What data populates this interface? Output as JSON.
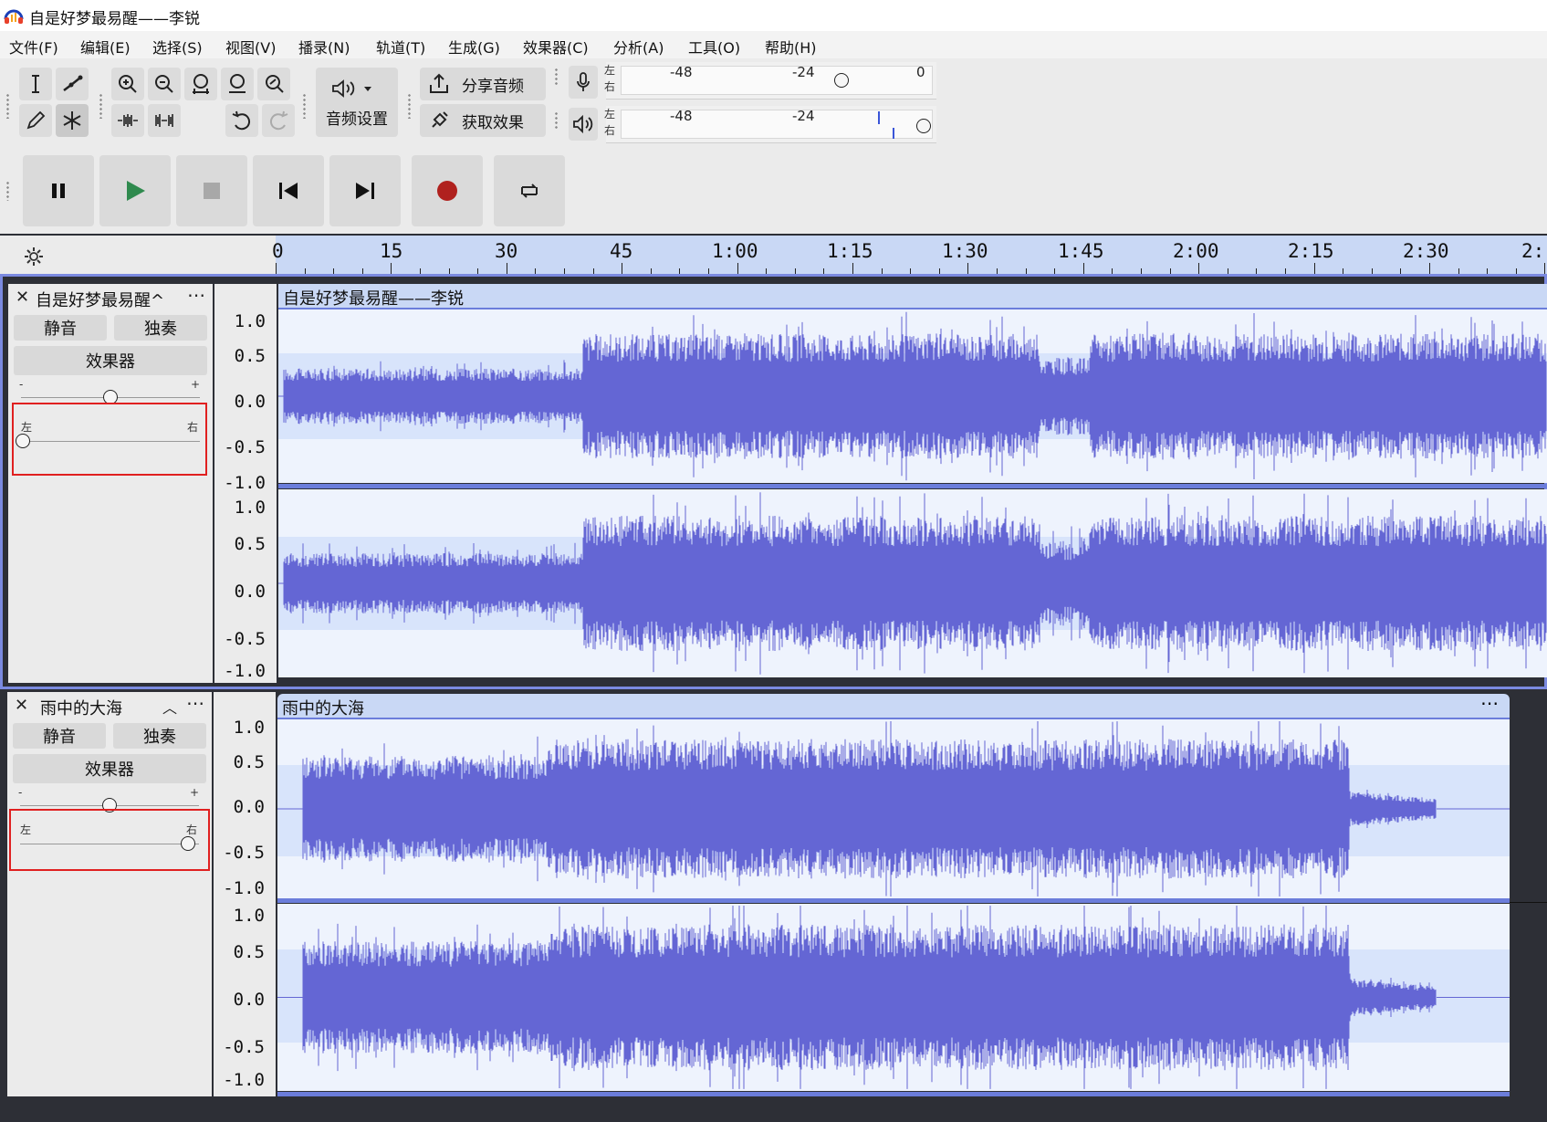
{
  "window": {
    "title": "自是好梦最易醒——李锐"
  },
  "menu": [
    "文件(F)",
    "编辑(E)",
    "选择(S)",
    "视图(V)",
    "播录(N)",
    "轨道(T)",
    "生成(G)",
    "效果器(C)",
    "分析(A)",
    "工具(O)",
    "帮助(H)"
  ],
  "toolbar": {
    "audio_settings": "音频设置",
    "share_audio": "分享音频",
    "get_effects": "获取效果",
    "meter_left": "左",
    "meter_right": "右",
    "rec_meter_ticks": [
      "-48",
      "-24",
      "0"
    ],
    "play_meter_ticks": [
      "-48",
      "-24"
    ]
  },
  "ruler": {
    "labels": [
      "0",
      "15",
      "30",
      "45",
      "1:00",
      "1:15",
      "1:30",
      "1:45",
      "2:00",
      "2:15",
      "2:30",
      "2:"
    ]
  },
  "tracks": [
    {
      "name": "自是好梦最易醒^",
      "clip_name": "自是好梦最易醒——李锐",
      "mute": "静音",
      "solo": "独奏",
      "effects": "效果器",
      "pan_left": "左",
      "pan_right": "右",
      "gain_minus": "-",
      "gain_plus": "+",
      "scale": [
        "1.0",
        "0.5",
        "0.0",
        "-0.5",
        "-1.0"
      ]
    },
    {
      "name": "雨中的大海",
      "clip_name": "雨中的大海",
      "mute": "静音",
      "solo": "独奏",
      "effects": "效果器",
      "pan_left": "左",
      "pan_right": "右",
      "gain_minus": "-",
      "gain_plus": "+",
      "scale": [
        "1.0",
        "0.5",
        "0.0",
        "-0.5",
        "-1.0"
      ]
    }
  ],
  "colors": {
    "waveform": "#6466d4",
    "clip_header": "#c9d8f5",
    "selection_box": "#e02020"
  }
}
